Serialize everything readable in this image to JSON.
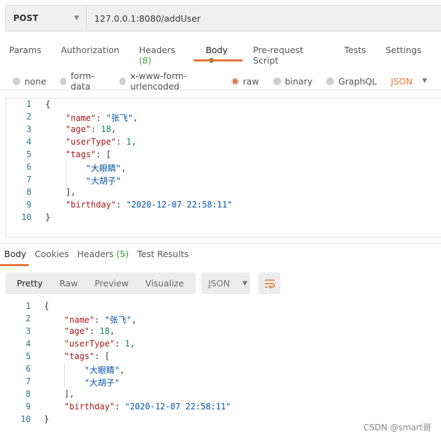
{
  "request": {
    "method": "POST",
    "url": "127.0.0.1:8080/addUser"
  },
  "request_tabs": [
    {
      "label": "Params"
    },
    {
      "label": "Authorization"
    },
    {
      "label": "Headers",
      "count": "(8)"
    },
    {
      "label": "Body",
      "active": true,
      "dot": true
    },
    {
      "label": "Pre-request Script"
    },
    {
      "label": "Tests"
    },
    {
      "label": "Settings"
    }
  ],
  "body_types": [
    {
      "label": "none"
    },
    {
      "label": "form-data"
    },
    {
      "label": "x-www-form-urlencoded"
    },
    {
      "label": "raw",
      "selected": true
    },
    {
      "label": "binary"
    },
    {
      "label": "GraphQL"
    }
  ],
  "body_format": "JSON",
  "accent_color": "#e8743b",
  "code_lines": [
    [
      {
        "t": "{",
        "c": ""
      }
    ],
    [
      {
        "t": "    ",
        "c": ""
      },
      {
        "t": "\"name\"",
        "c": "k"
      },
      {
        "t": ": ",
        "c": ""
      },
      {
        "t": "\"张飞\"",
        "c": "s"
      },
      {
        "t": ",",
        "c": ""
      }
    ],
    [
      {
        "t": "    ",
        "c": ""
      },
      {
        "t": "\"age\"",
        "c": "k"
      },
      {
        "t": ": ",
        "c": ""
      },
      {
        "t": "18",
        "c": "n"
      },
      {
        "t": ",",
        "c": ""
      }
    ],
    [
      {
        "t": "    ",
        "c": ""
      },
      {
        "t": "\"userType\"",
        "c": "k"
      },
      {
        "t": ": ",
        "c": ""
      },
      {
        "t": "1",
        "c": "n"
      },
      {
        "t": ",",
        "c": ""
      }
    ],
    [
      {
        "t": "    ",
        "c": ""
      },
      {
        "t": "\"tags\"",
        "c": "k"
      },
      {
        "t": ": [",
        "c": ""
      }
    ],
    [
      {
        "t": "        ",
        "c": ""
      },
      {
        "t": "\"大眼睛\"",
        "c": "s"
      },
      {
        "t": ",",
        "c": ""
      }
    ],
    [
      {
        "t": "        ",
        "c": ""
      },
      {
        "t": "\"大胡子\"",
        "c": "s"
      }
    ],
    [
      {
        "t": "    ],",
        "c": ""
      }
    ],
    [
      {
        "t": "    ",
        "c": ""
      },
      {
        "t": "\"birthday\"",
        "c": "k"
      },
      {
        "t": ": ",
        "c": ""
      },
      {
        "t": "\"2020-12-07 22:58:11\"",
        "c": "s"
      }
    ],
    [
      {
        "t": "}",
        "c": ""
      }
    ]
  ],
  "response_tabs": [
    {
      "label": "Body",
      "active": true
    },
    {
      "label": "Cookies"
    },
    {
      "label": "Headers",
      "count": "(5)"
    },
    {
      "label": "Test Results"
    }
  ],
  "view_modes": [
    {
      "label": "Pretty",
      "active": true
    },
    {
      "label": "Raw"
    },
    {
      "label": "Preview"
    },
    {
      "label": "Visualize"
    }
  ],
  "response_format": "JSON",
  "watermark": "CSDN @smart哥"
}
